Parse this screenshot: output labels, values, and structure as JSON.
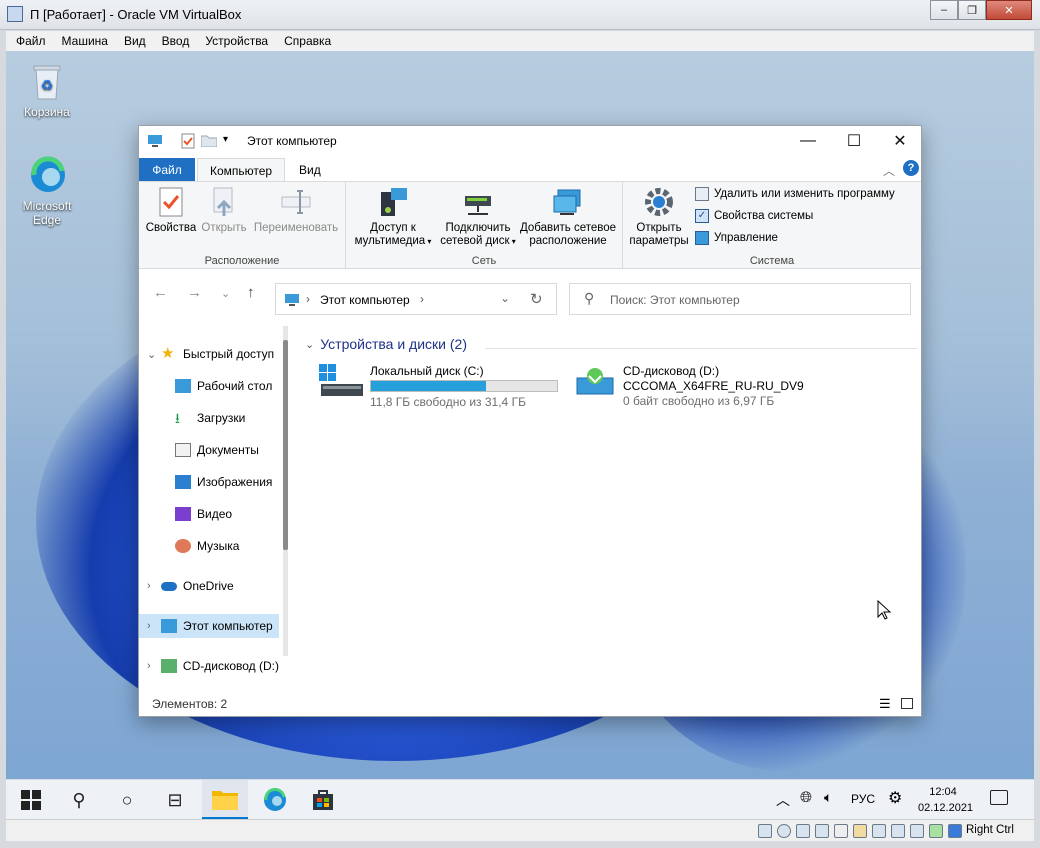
{
  "vbox": {
    "title": "П [Работает] - Oracle VM VirtualBox",
    "menu": [
      "Файл",
      "Машина",
      "Вид",
      "Ввод",
      "Устройства",
      "Справка"
    ],
    "host_key": "Right Ctrl"
  },
  "desktop": {
    "icons": [
      {
        "label": "Корзина",
        "icon": "recycle-bin-icon"
      },
      {
        "label": "Microsoft Edge",
        "icon": "edge-icon"
      }
    ]
  },
  "explorer": {
    "title": "Этот компьютер",
    "tabs": {
      "file": "Файл",
      "computer": "Компьютер",
      "view": "Вид"
    },
    "ribbon": {
      "groups": {
        "location": "Расположение",
        "network": "Сеть",
        "system": "Система"
      },
      "properties": "Свойства",
      "open": "Открыть",
      "rename": "Переименовать",
      "media_access_1": "Доступ к",
      "media_access_2": "мультимедиа",
      "map_drive_1": "Подключить",
      "map_drive_2": "сетевой диск",
      "add_location_1": "Добавить сетевое",
      "add_location_2": "расположение",
      "open_settings_1": "Открыть",
      "open_settings_2": "параметры",
      "uninstall": "Удалить или изменить программу",
      "sys_props": "Свойства системы",
      "manage": "Управление"
    },
    "address": {
      "crumb": "Этот компьютер",
      "search_placeholder": "Поиск: Этот компьютер"
    },
    "nav": {
      "quick_access": "Быстрый доступ",
      "desktop": "Рабочий стол",
      "downloads": "Загрузки",
      "documents": "Документы",
      "pictures": "Изображения",
      "video": "Видео",
      "music": "Музыка",
      "onedrive": "OneDrive",
      "this_pc": "Этот компьютер",
      "cd_drive": "CD-дисковод (D:)"
    },
    "group_header": "Устройства и диски (2)",
    "drives": [
      {
        "name": "Локальный диск (C:)",
        "free": "11,8 ГБ свободно из 31,4 ГБ",
        "used_fraction": 0.62
      },
      {
        "name": "CD-дисковод (D:)",
        "label": "CCCOMA_X64FRE_RU-RU_DV9",
        "free": "0 байт свободно из 6,97 ГБ"
      }
    ],
    "status": "Элементов: 2"
  },
  "taskbar": {
    "lang": "РУС",
    "time": "12:04",
    "date": "02.12.2021"
  },
  "colors": {
    "accent": "#1f6fc3",
    "bar_fill": "#26a0da",
    "selection": "#cce4f7",
    "taskbar_indicator": "#0078d4"
  }
}
